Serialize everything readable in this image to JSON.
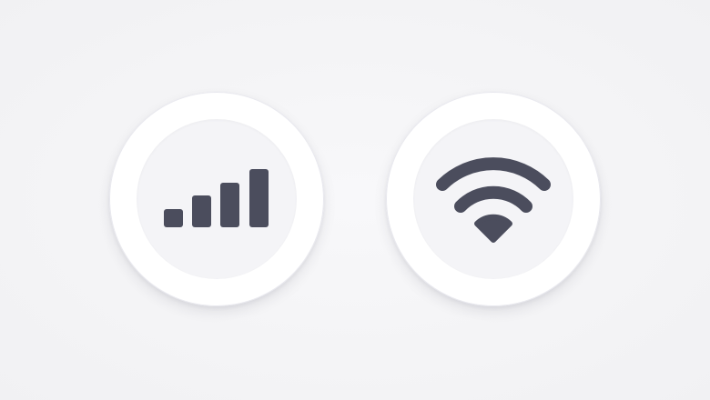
{
  "controls": [
    {
      "id": "cellular",
      "icon": "cellular-signal-icon",
      "label": ""
    },
    {
      "id": "wifi",
      "icon": "wifi-icon",
      "label": ""
    }
  ],
  "colors": {
    "background": "#f5f5f7",
    "button": "#ffffff",
    "button_inner": "#f4f4f7",
    "icon": "#4b4d5d"
  }
}
